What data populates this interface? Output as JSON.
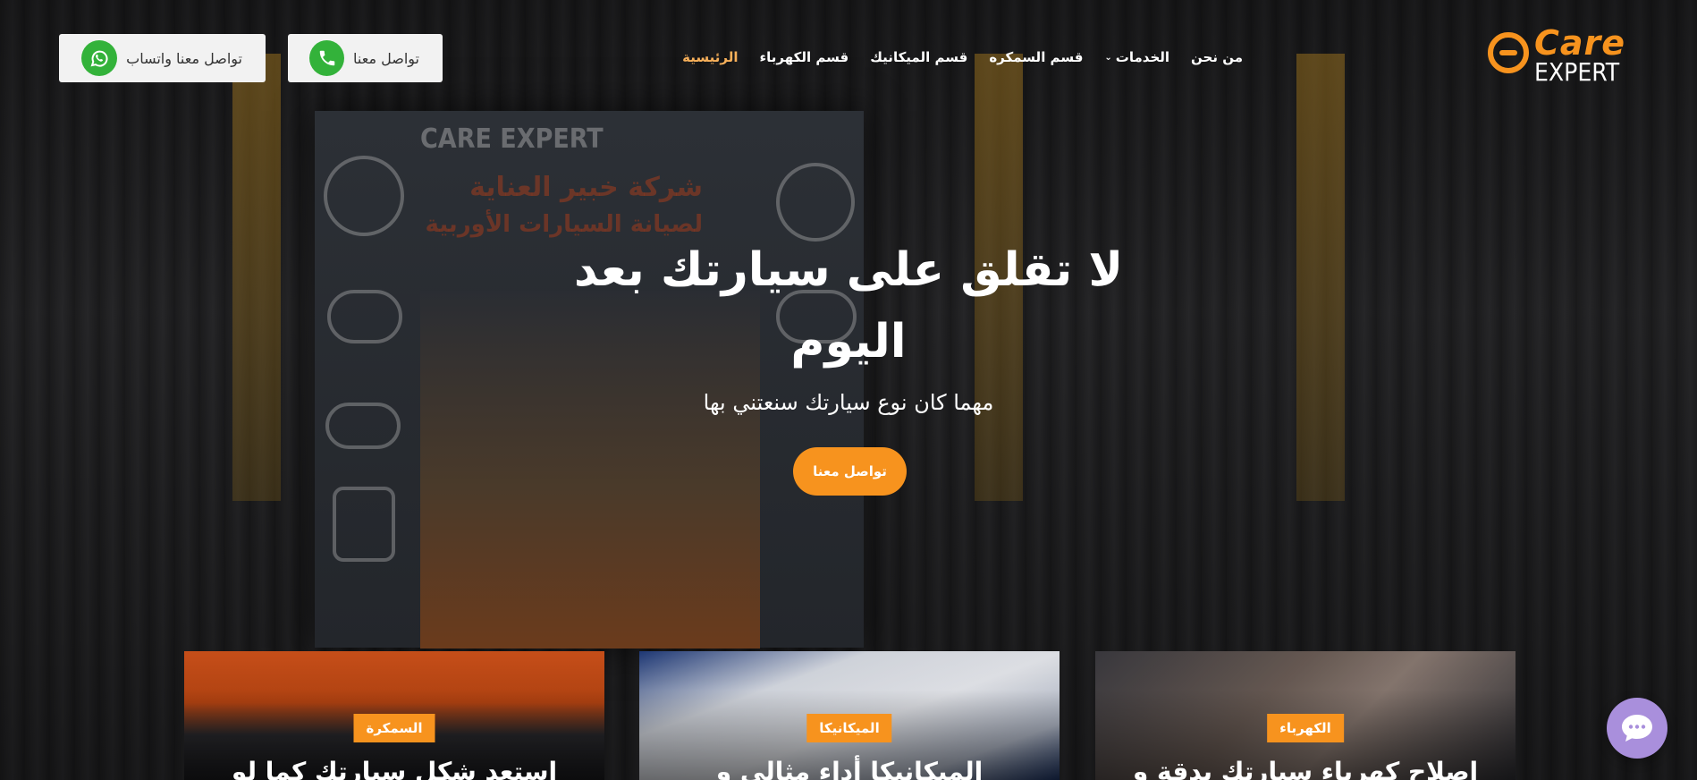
{
  "brand": {
    "logo_word1": "Care",
    "logo_word2": "EXPERT",
    "accent_color": "#f7931e"
  },
  "nav": {
    "items": [
      {
        "label": "الرئيسية",
        "active": true
      },
      {
        "label": "قسم الكهرباء",
        "active": false
      },
      {
        "label": "قسم الميكانيك",
        "active": false
      },
      {
        "label": "قسم السمكره",
        "active": false
      },
      {
        "label": "الخدمات",
        "active": false,
        "has_dropdown": true
      },
      {
        "label": "من نحن",
        "active": false
      }
    ]
  },
  "header_buttons": {
    "call": {
      "label": "تواصل معنا",
      "icon": "phone-icon"
    },
    "whatsapp": {
      "label": "تواصل معنا واتساب",
      "icon": "whatsapp-icon"
    }
  },
  "hero": {
    "title_line1": "لا تقلق على سيارتك بعد",
    "title_line2": "اليوم",
    "subtitle": "مهما كان نوع سيارتك سنعتني بها",
    "cta": "تواصل معنا",
    "wall_brand": "CARE EXPERT",
    "wall_line1": "شركة خبير العناية",
    "wall_line2": "لصيانة السيارات الأوربية"
  },
  "cards": [
    {
      "badge": "الكهرباء",
      "title": "اصلاح كهرباء سيارتك بدقة و"
    },
    {
      "badge": "الميكانيكا",
      "title": "الميكانيكا أداء مثالي و"
    },
    {
      "badge": "السمكرة",
      "title": "استعد شكل سيارتك كما لو"
    }
  ],
  "chat": {
    "icon": "chat-icon"
  }
}
